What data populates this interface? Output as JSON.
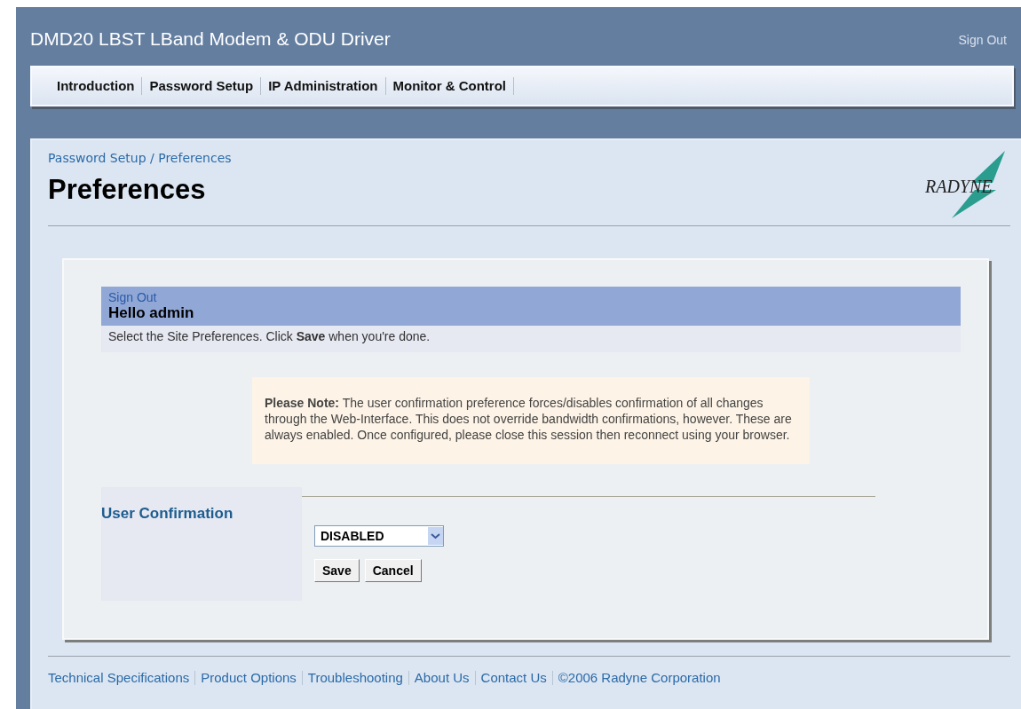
{
  "header": {
    "title": "DMD20 LBST LBand Modem & ODU Driver",
    "sign_out": "Sign Out"
  },
  "nav": [
    {
      "label": "Introduction",
      "selected": false
    },
    {
      "label": "Password Setup",
      "selected": false
    },
    {
      "label": "IP Administration",
      "selected": false
    },
    {
      "label": "Monitor & Control",
      "selected": false
    }
  ],
  "breadcrumb": "Password Setup / Preferences",
  "page_title": "Preferences",
  "logo": "RADYNE",
  "panel": {
    "sign_out": "Sign Out",
    "greeting": "Hello admin",
    "instruction": "Select the Site Preferences. Click **Save** when you're done.",
    "note": "**Please Note:**  The user confirmation preference forces/disables confirmation of all changes through the Web-Interface. This does not override bandwidth confirmations, however. These are always enabled. Once configured, please close this session then reconnect using your browser.",
    "field_label": "User Confirmation",
    "select_value": "DISABLED",
    "buttons": [
      "Save",
      "Cancel"
    ]
  },
  "footer": [
    "Technical Specifications",
    "Product Options",
    "Troubleshooting",
    "About Us",
    "Contact Us",
    "©2006 Radyne Corporation"
  ]
}
